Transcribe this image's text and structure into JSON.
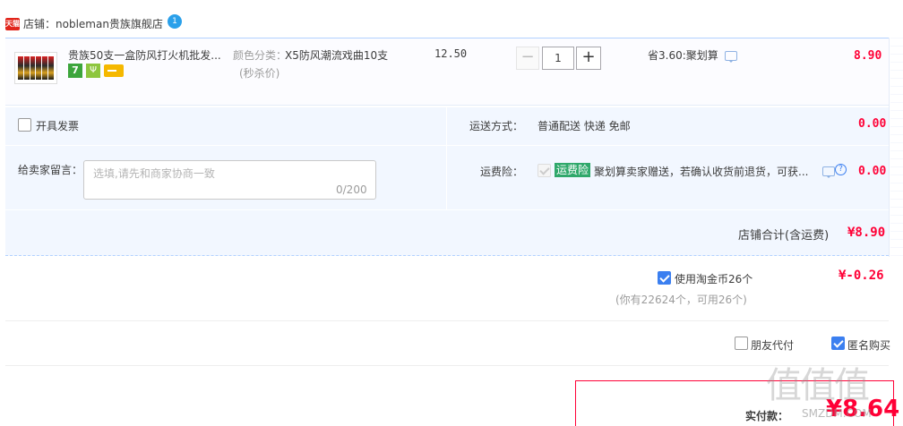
{
  "store": {
    "badge": "天猫",
    "name": "店铺：nobleman贵族旗舰店",
    "ww_badge": "1"
  },
  "item": {
    "title": "贵族50支一盒防风打火机批发...",
    "tags": {
      "seven_day": "7",
      "shield": "Ψ"
    },
    "sku_label": "颜色分类：",
    "sku_value": "X5防风潮流戏曲10支",
    "sku_note": "(秒杀价)",
    "unit_price": "12.50",
    "quantity": "1",
    "minus": "−",
    "plus": "+",
    "saving": "省3.60:聚划算",
    "total": "8.90"
  },
  "options": {
    "invoice_label": "开具发票",
    "shipping_label": "运送方式：",
    "shipping_value": "普通配送 快递 免邮",
    "shipping_price": "0.00",
    "message_label": "给卖家留言：",
    "message_placeholder": "选填,请先和商家协商一致",
    "message_count": "0/200",
    "insurance_label": "运费险：",
    "insurance_badge": "运费险",
    "insurance_text": "聚划算卖家赠送，若确认收货前退货，可获...",
    "insurance_help": "?",
    "insurance_price": "0.00",
    "store_total_label": "店铺合计(含运费)",
    "store_total_value": "¥8.90"
  },
  "coins": {
    "label": "使用淘金币26个",
    "value": "¥-0.26",
    "note": "(你有22624个，可用26个)"
  },
  "extras": {
    "friend_pay": "朋友代付",
    "anonymous": "匿名购买"
  },
  "payment": {
    "label": "实付款：",
    "value": "¥8.64"
  },
  "watermark": {
    "main": "值值值",
    "sub": "SMZDM.COM"
  },
  "colors": {
    "accent_red": "#ff0036",
    "checkbox_blue": "#3b7ff0",
    "panel_blue": "#f2f7ff",
    "insurance_green": "#2fa86b"
  }
}
